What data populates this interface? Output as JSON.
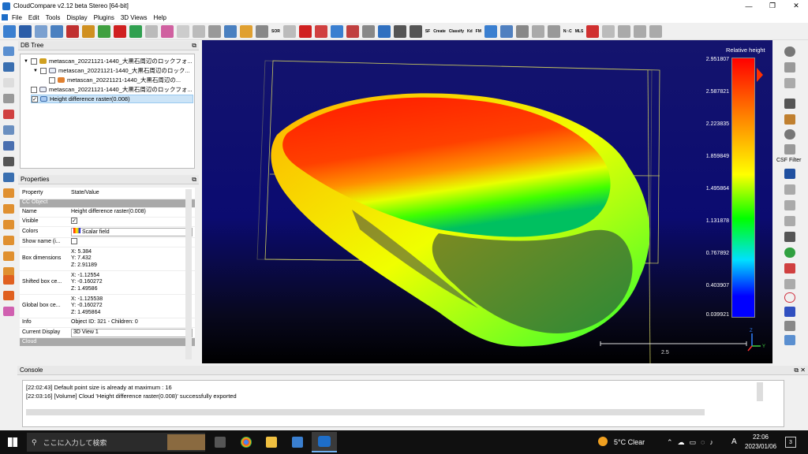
{
  "window": {
    "title": "CloudCompare v2.12 beta Stereo [64-bit]",
    "min": "—",
    "max": "❐",
    "close": "✕"
  },
  "menu": [
    "File",
    "Edit",
    "Tools",
    "Display",
    "Plugins",
    "3D Views",
    "Help"
  ],
  "toolbar": {
    "sor": "SOR",
    "sf": "SF",
    "kd": "Kd",
    "fm": "FM",
    "mls": "MLS",
    "nc": "N∩C",
    "create": "Create",
    "classify": "Classify"
  },
  "db_tree": {
    "title": "DB Tree",
    "items": [
      {
        "label": "metascan_20221121-1440_大黒石周辺のロックフォ...",
        "checked": false,
        "indent": 0,
        "expand": "▼"
      },
      {
        "label": "metascan_20221121-1440_大黒石周辺のロック...",
        "checked": false,
        "indent": 1,
        "expand": "▼"
      },
      {
        "label": "metascan_20221121-1440_大黒石周辺の...",
        "checked": false,
        "indent": 2,
        "expand": ""
      },
      {
        "label": "metascan_20221121-1440_大黒石周辺のロックフォ...",
        "checked": false,
        "indent": 0,
        "expand": ""
      },
      {
        "label": "Height difference raster(0.008)",
        "checked": true,
        "indent": 0,
        "expand": "",
        "selected": true
      }
    ]
  },
  "properties": {
    "title": "Properties",
    "col1": "Property",
    "col2": "State/Value",
    "section1": "CC Object",
    "section2": "Cloud",
    "rows": [
      {
        "k": "Name",
        "v": "Height difference raster(0.008)"
      },
      {
        "k": "Visible",
        "v": "✓"
      },
      {
        "k": "Colors",
        "v": "Scalar field"
      },
      {
        "k": "Show name (i...",
        "v": ""
      },
      {
        "k": "Box dimensions",
        "v": "X: 5.384\nY: 7.432\nZ: 2.91189"
      },
      {
        "k": "Shifted box ce...",
        "v": "X: -1.12554\nY: -0.160272\nZ: 1.49586"
      },
      {
        "k": "Global box ce...",
        "v": "X: -1.125538\nY: -0.160272\nZ: 1.495864"
      },
      {
        "k": "Info",
        "v": "Object ID: 321 - Children: 0"
      },
      {
        "k": "Current Display",
        "v": "3D View 1"
      }
    ]
  },
  "view": {
    "sf_title": "Relative height",
    "ticks": [
      "2.951807",
      "2.587821",
      "2.223835",
      "1.859849",
      "1.495864",
      "1.131878",
      "0.767892",
      "0.403907",
      "0.039921"
    ],
    "scale_label": "2.5",
    "axes": {
      "z": "Z",
      "y": "Y",
      "x": "X"
    }
  },
  "right_tools": {
    "csf": "CSF Filter"
  },
  "console": {
    "title": "Console",
    "lines": [
      "[22:02:43] Default point size is already at maximum : 16",
      "[22:03:16] [Volume] Cloud 'Height difference raster(0.008)' successfully exported"
    ]
  },
  "taskbar": {
    "search_placeholder": "ここに入力して検索",
    "weather": "5°C  Clear",
    "lang": "A",
    "time": "22:06",
    "date": "2023/01/06",
    "notif": "3"
  }
}
